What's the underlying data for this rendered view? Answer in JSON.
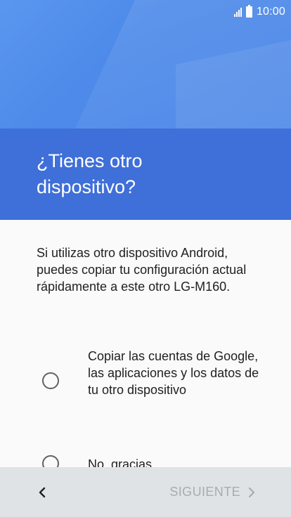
{
  "status_bar": {
    "time": "10:00",
    "icons": [
      "signal-icon",
      "battery-icon"
    ]
  },
  "header": {
    "title": "¿Tienes otro dispositivo?"
  },
  "content": {
    "intro": "Si utilizas otro dispositivo Android, puedes copiar tu configuración actual rápidamente a este otro LG-M160.",
    "options": [
      {
        "label": "Copiar las cuentas de Google, las aplicaciones y los datos de tu otro dispositivo",
        "selected": false
      },
      {
        "label": "No, gracias",
        "selected": false
      }
    ]
  },
  "navigation": {
    "back_icon": "chevron-left-icon",
    "next_label": "SIGUIENTE",
    "next_icon": "chevron-right-icon",
    "next_enabled": false
  },
  "colors": {
    "hero_blue": "#4a86e8",
    "title_blue": "#3f6fd8",
    "background": "#fafafa",
    "bottom_bar": "#dfe3e6",
    "disabled_text": "#a8acaf"
  }
}
